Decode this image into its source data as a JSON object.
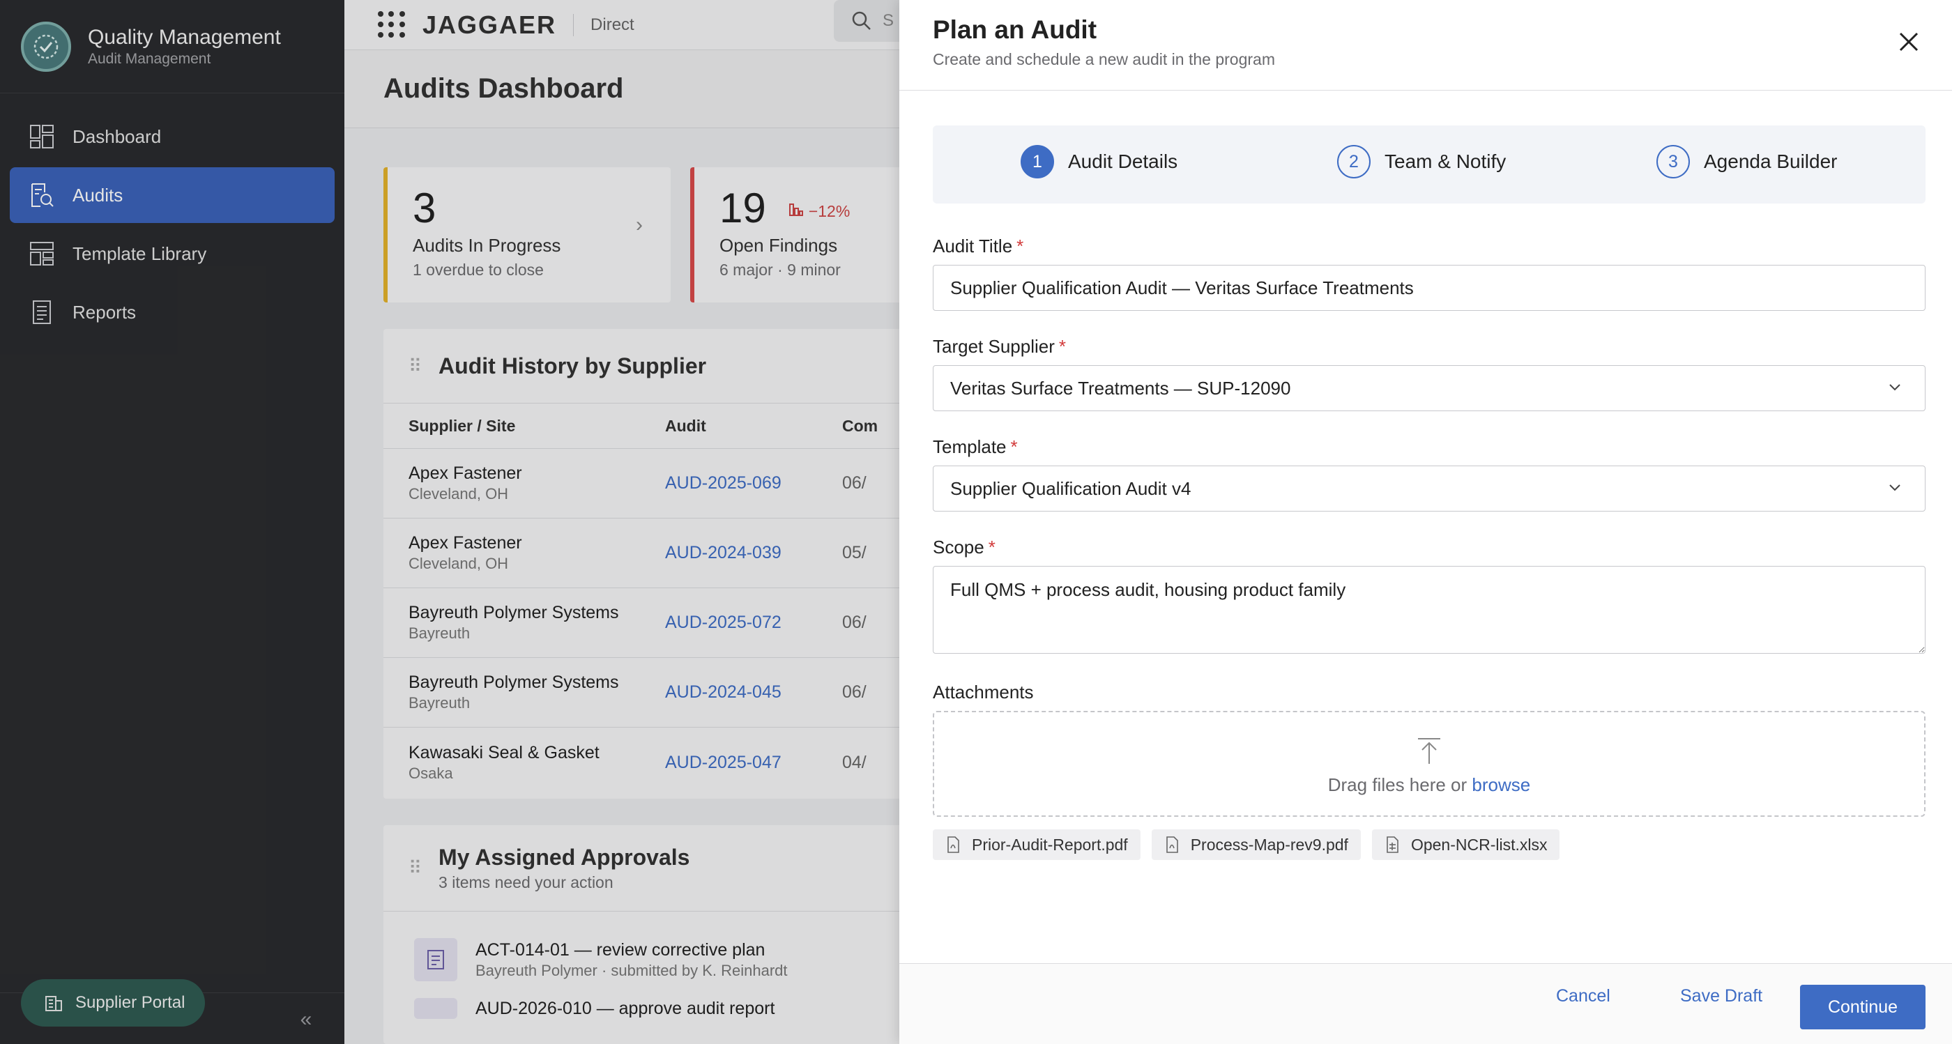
{
  "app": {
    "title": "Quality Management",
    "subtitle": "Audit Management"
  },
  "sidebar": {
    "items": [
      {
        "label": "Dashboard",
        "icon": "dashboard-icon"
      },
      {
        "label": "Audits",
        "icon": "audit-search-icon",
        "active": true
      },
      {
        "label": "Template Library",
        "icon": "template-icon"
      },
      {
        "label": "Reports",
        "icon": "report-icon"
      }
    ],
    "portal_label": "Supplier Portal"
  },
  "topbar": {
    "logo": "JAGGAER",
    "context": "Direct",
    "search_placeholder": "S"
  },
  "page": {
    "title": "Audits Dashboard"
  },
  "kpis": [
    {
      "value": "3",
      "label": "Audits In Progress",
      "sub": "1 overdue to close"
    },
    {
      "value": "19",
      "trend": "−12%",
      "label": "Open Findings",
      "sub": "6 major · 9 minor"
    }
  ],
  "history": {
    "title": "Audit History by Supplier",
    "columns": [
      "Supplier / Site",
      "Audit",
      "Com"
    ],
    "rows": [
      {
        "supplier": "Apex Fastener",
        "site": "Cleveland, OH",
        "audit": "AUD-2025-069",
        "date": "06/"
      },
      {
        "supplier": "Apex Fastener",
        "site": "Cleveland, OH",
        "audit": "AUD-2024-039",
        "date": "05/"
      },
      {
        "supplier": "Bayreuth Polymer Systems",
        "site": "Bayreuth",
        "audit": "AUD-2025-072",
        "date": "06/"
      },
      {
        "supplier": "Bayreuth Polymer Systems",
        "site": "Bayreuth",
        "audit": "AUD-2024-045",
        "date": "06/"
      },
      {
        "supplier": "Kawasaki Seal & Gasket",
        "site": "Osaka",
        "audit": "AUD-2025-047",
        "date": "04/"
      }
    ]
  },
  "approvals": {
    "title": "My Assigned Approvals",
    "sub": "3 items need your action",
    "items": [
      {
        "title": "ACT-014-01 — review corrective plan",
        "sub": "Bayreuth Polymer · submitted by K. Reinhardt"
      },
      {
        "title": "AUD-2026-010 — approve audit report",
        "sub": ""
      }
    ]
  },
  "drawer": {
    "title": "Plan an Audit",
    "subtitle": "Create and schedule a new audit in the program",
    "steps": [
      {
        "num": "1",
        "label": "Audit Details"
      },
      {
        "num": "2",
        "label": "Team & Notify"
      },
      {
        "num": "3",
        "label": "Agenda Builder"
      }
    ],
    "fields": {
      "audit_title_label": "Audit Title",
      "audit_title_value": "Supplier Qualification Audit — Veritas Surface Treatments",
      "supplier_label": "Target Supplier",
      "supplier_value": "Veritas Surface Treatments — SUP-12090",
      "template_label": "Template",
      "template_value": "Supplier Qualification Audit v4",
      "scope_label": "Scope",
      "scope_value": "Full QMS + process audit, housing product family",
      "attachments_label": "Attachments",
      "dropzone_text": "Drag files here or",
      "dropzone_link": "browse"
    },
    "attachments": [
      "Prior-Audit-Report.pdf",
      "Process-Map-rev9.pdf",
      "Open-NCR-list.xlsx"
    ],
    "footer": {
      "cancel": "Cancel",
      "save_draft": "Save Draft",
      "continue": "Continue"
    }
  },
  "colors": {
    "accent": "#3e6cc4",
    "sidebar_bg": "#2a2b2e",
    "required": "#d23b3b",
    "kpi_warning": "#e3b12b",
    "kpi_danger": "#d84a4a"
  }
}
